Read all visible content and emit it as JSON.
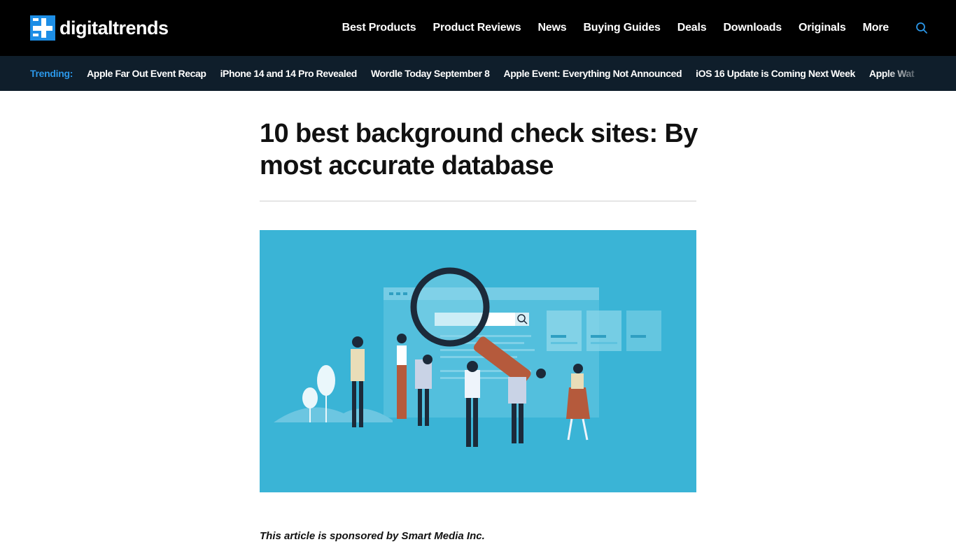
{
  "header": {
    "logo_text": "digitaltrends",
    "nav": [
      {
        "label": "Best Products"
      },
      {
        "label": "Product Reviews"
      },
      {
        "label": "News"
      },
      {
        "label": "Buying Guides"
      },
      {
        "label": "Deals"
      },
      {
        "label": "Downloads"
      },
      {
        "label": "Originals"
      },
      {
        "label": "More"
      }
    ],
    "search_icon": "search-icon"
  },
  "trending": {
    "label": "Trending:",
    "items": [
      {
        "label": "Apple Far Out Event Recap"
      },
      {
        "label": "iPhone 14 and 14 Pro Revealed"
      },
      {
        "label": "Wordle Today September 8"
      },
      {
        "label": "Apple Event: Everything Not Announced"
      },
      {
        "label": "iOS 16 Update is Coming Next Week"
      },
      {
        "label": "Apple Wat"
      }
    ]
  },
  "article": {
    "title": "10 best background check sites: By most accurate database",
    "hero_alt": "illustration-people-with-magnifying-glass",
    "byline": "This article is sponsored by Smart Media Inc."
  },
  "colors": {
    "header_bg": "#000000",
    "trending_bg": "#0f1e2b",
    "accent": "#1d8ee6",
    "hero_bg": "#3ab4d6"
  }
}
